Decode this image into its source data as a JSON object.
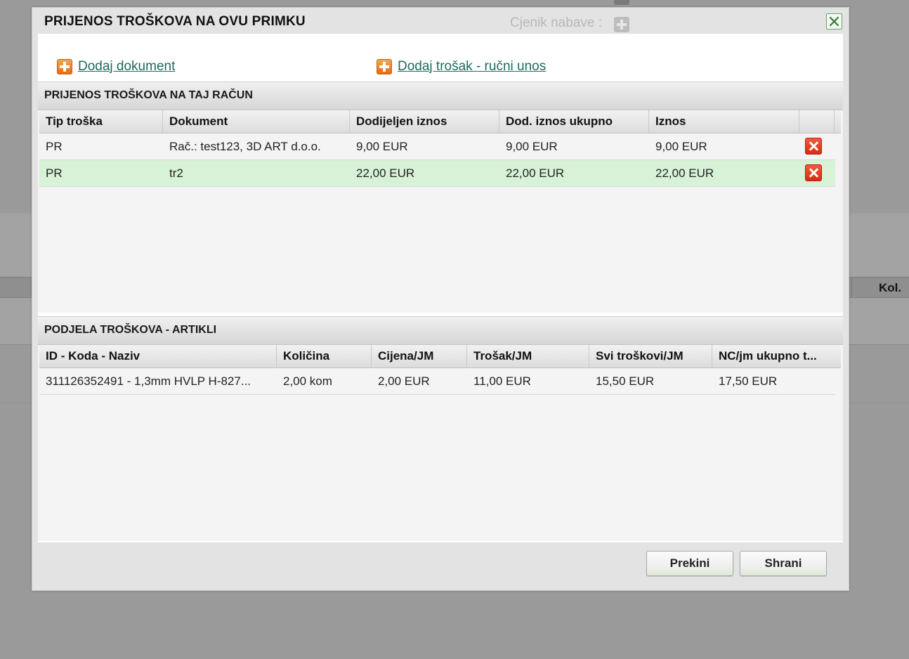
{
  "background": {
    "cjenik_label": "Cjenik nabave :",
    "column_kol": "Kol."
  },
  "modal": {
    "title": "PRIJENOS TROŠKOVA NA OVU PRIMKU",
    "close_icon": "close-icon",
    "links": {
      "add_document": "Dodaj dokument",
      "add_cost_manual": "Dodaj trošak - ručni unos"
    },
    "cost_transfer": {
      "header": "PRIJENOS TROŠKOVA NA TAJ RAČUN",
      "columns": [
        "Tip troška",
        "Dokument",
        "Dodijeljen iznos",
        "Dod. iznos ukupno",
        "Iznos",
        ""
      ],
      "rows": [
        {
          "tip": "PR",
          "dokument": "Rač.: test123, 3D ART d.o.o.",
          "dodijeljen": "9,00 EUR",
          "ukupno": "9,00 EUR",
          "iznos": "9,00 EUR",
          "selected": false
        },
        {
          "tip": "PR",
          "dokument": "tr2",
          "dodijeljen": "22,00 EUR",
          "ukupno": "22,00 EUR",
          "iznos": "22,00 EUR",
          "selected": true
        }
      ]
    },
    "cost_distribution": {
      "header": "PODJELA TROŠKOVA - ARTIKLI",
      "columns": [
        "ID - Koda - Naziv",
        "Količina",
        "Cijena/JM",
        "Trošak/JM",
        "Svi troškovi/JM",
        "NC/jm ukupno t..."
      ],
      "rows": [
        {
          "id_naziv": "311126352491 - 1,3mm HVLP H-827...",
          "kolicina": "2,00 kom",
          "cijena": "2,00 EUR",
          "trosak": "11,00 EUR",
          "svi_troskovi": "15,50 EUR",
          "nc_ukupno": "17,50 EUR"
        }
      ]
    },
    "buttons": {
      "cancel": "Prekini",
      "save": "Shrani"
    }
  },
  "colors": {
    "link": "#1e6b5c",
    "selected_row": "#d8f2d8",
    "delete": "#d62a12",
    "add": "#e76b12"
  }
}
